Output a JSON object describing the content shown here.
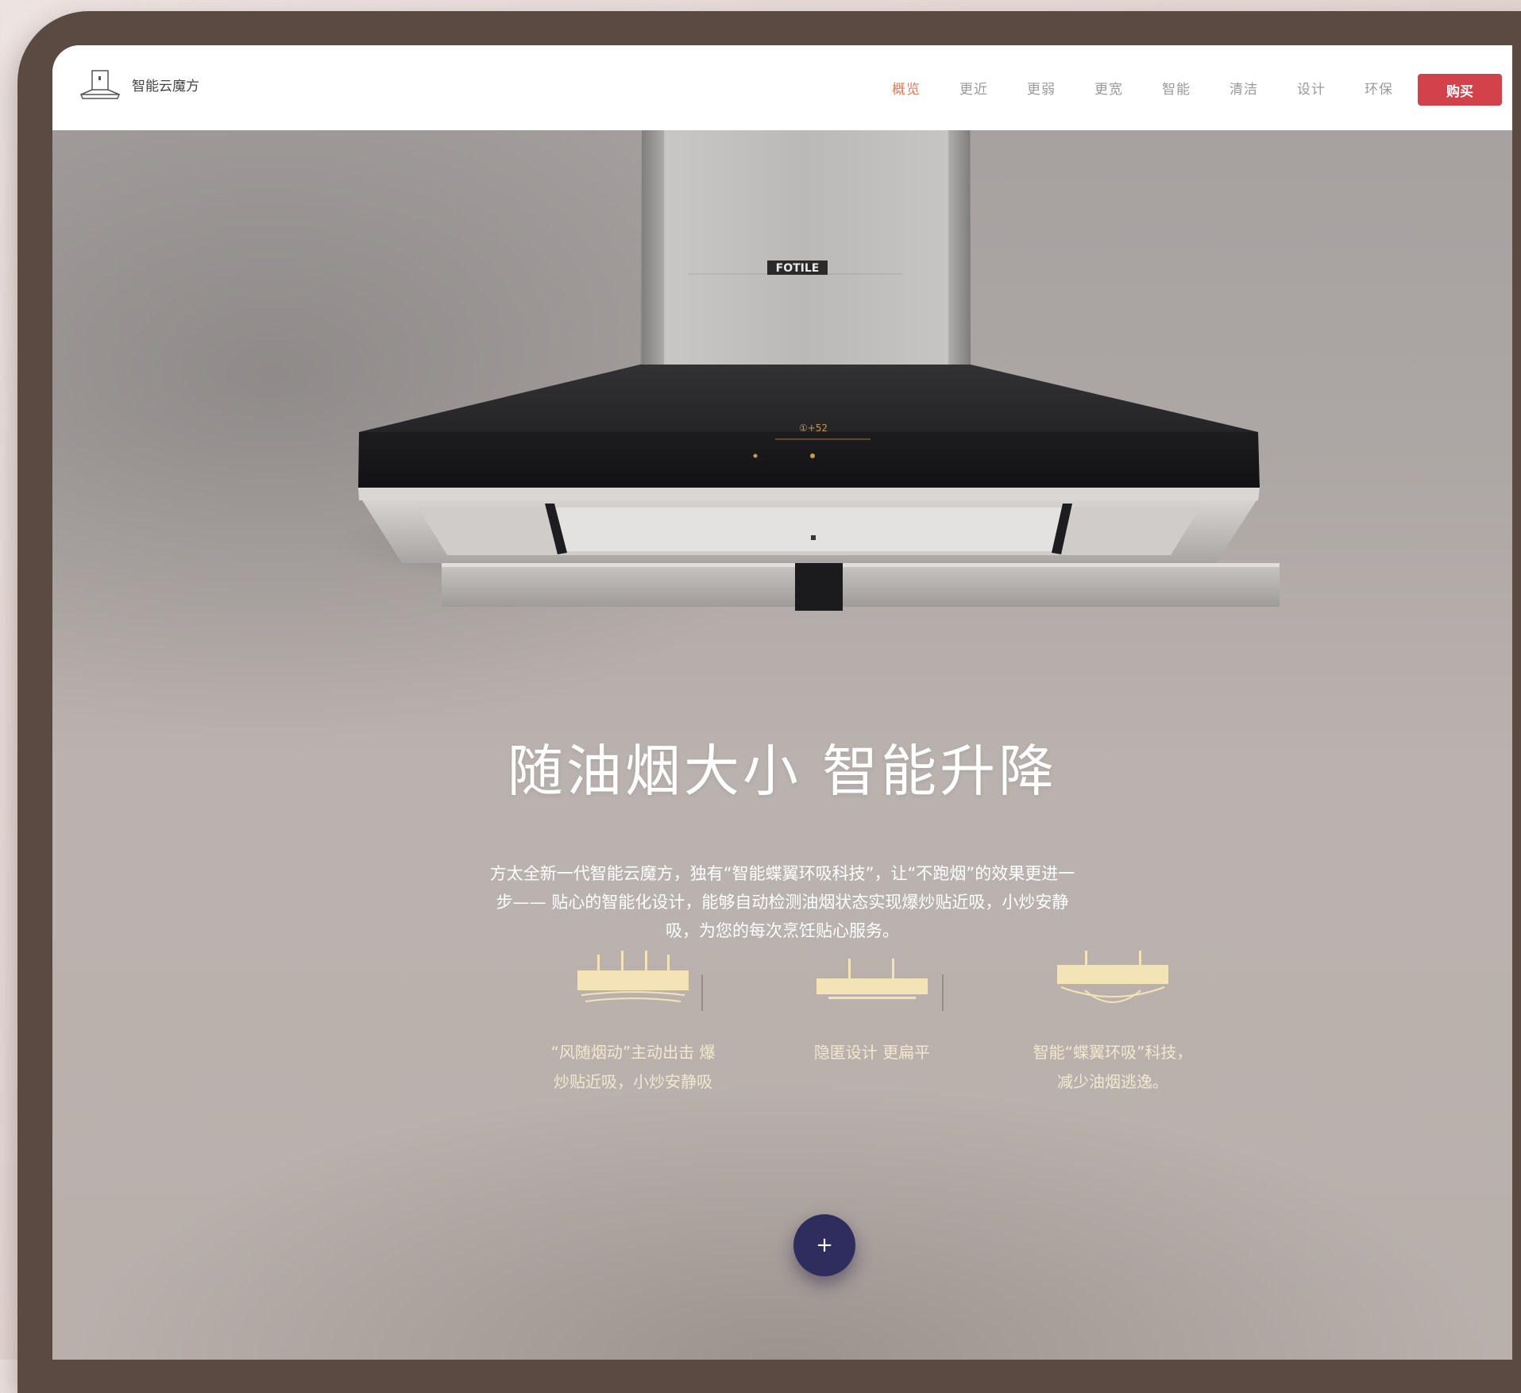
{
  "brand": {
    "name": "智能云魔方",
    "logo_icon": "range-hood-icon"
  },
  "nav": {
    "items": [
      "概览",
      "更近",
      "更弱",
      "更宽",
      "智能",
      "清洁",
      "设计",
      "环保"
    ],
    "active_index": 0,
    "buy_label": "购买"
  },
  "hero": {
    "product_brand_mark": "FOTILE",
    "headline": "随油烟大小 智能升降",
    "description": "方太全新一代智能云魔方，独有“智能蝶翼环吸科技”，让“不跑烟”的效果更进一步—— 贴心的智能化设计，能够自动检测油烟状态实现爆炒贴近吸，小炒安静吸，为您的每次烹饪贴心服务。"
  },
  "features": [
    {
      "icon": "hood-airflow-icon",
      "line1": "“风随烟动”主动出击 爆",
      "line2": "炒贴近吸，小炒安静吸"
    },
    {
      "icon": "hood-flat-icon",
      "line1": "隐匿设计 更扁平",
      "line2": ""
    },
    {
      "icon": "hood-butterfly-wing-icon",
      "line1": "智能“蝶翼环吸”科技，",
      "line2": "减少油烟逃逸。"
    }
  ],
  "fab": {
    "icon": "plus-icon",
    "label": "+"
  },
  "colors": {
    "frame": "#5a4a41",
    "nav_active": "#e37a5a",
    "buy_button": "#d3414b",
    "feature_gold": "#f3e3b6",
    "fab": "#2e2d5e"
  }
}
